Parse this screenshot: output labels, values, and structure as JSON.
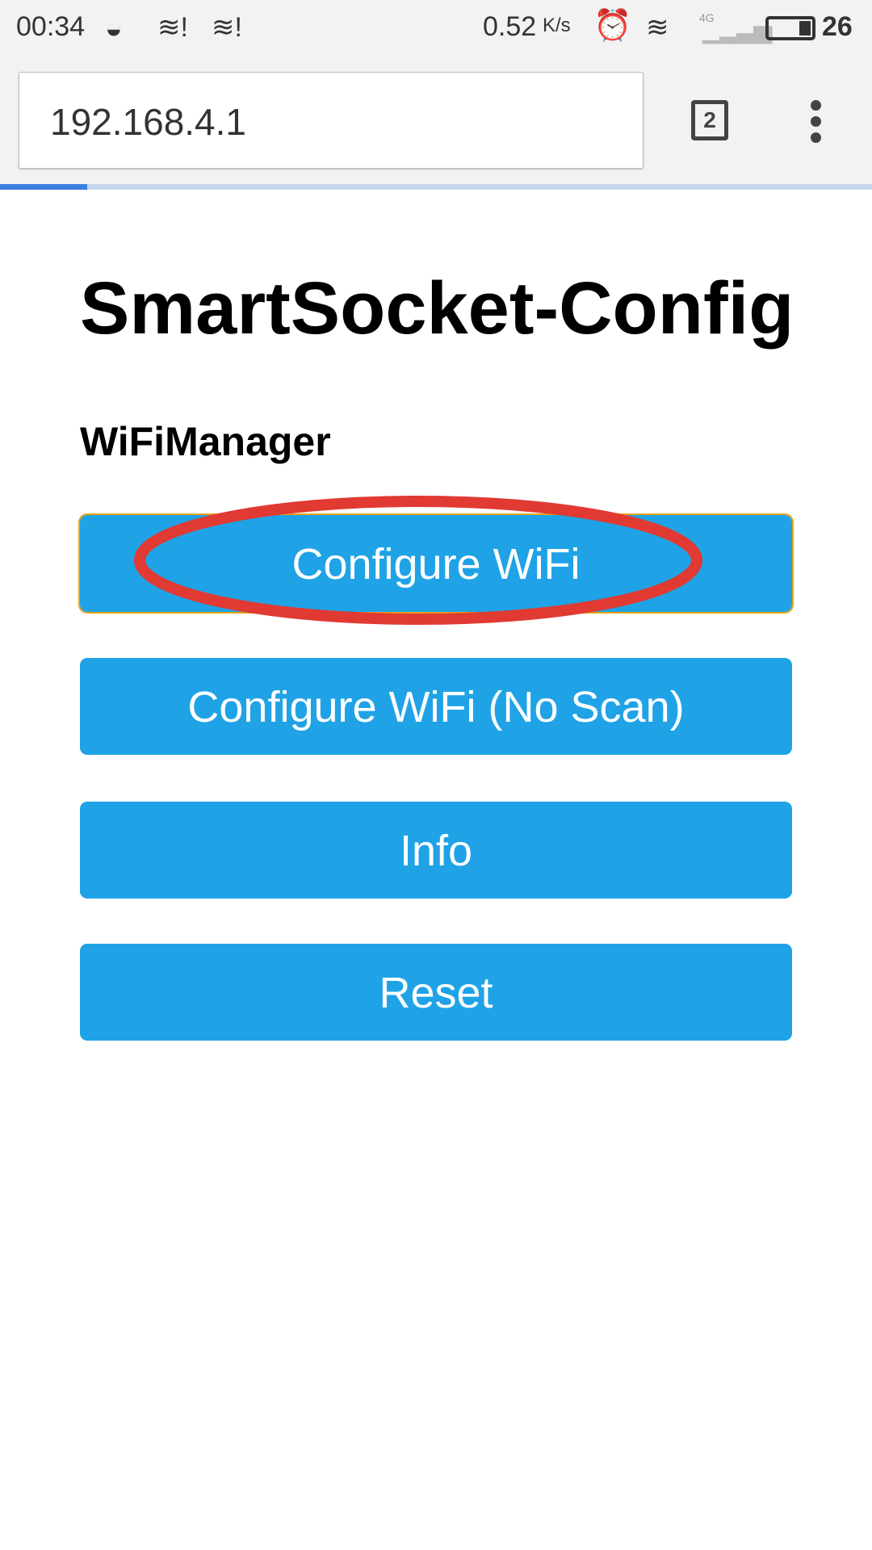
{
  "status_bar": {
    "time": "00:34",
    "net_speed": "0.52",
    "net_speed_unit": "K/s",
    "network_type": "4G",
    "battery": "26",
    "battery_level_percent": 26
  },
  "browser": {
    "url": "192.168.4.1",
    "tab_count": "2",
    "load_progress_percent": 10
  },
  "page": {
    "title": "SmartSocket-Config",
    "subtitle": "WiFiManager",
    "buttons": [
      {
        "label": "Configure WiFi"
      },
      {
        "label": "Configure WiFi (No Scan)"
      },
      {
        "label": "Info"
      },
      {
        "label": "Reset"
      }
    ]
  },
  "annotation": {
    "color": "#e03a33"
  },
  "colors": {
    "button": "#1fa3e6",
    "focus": "#e8a317"
  }
}
